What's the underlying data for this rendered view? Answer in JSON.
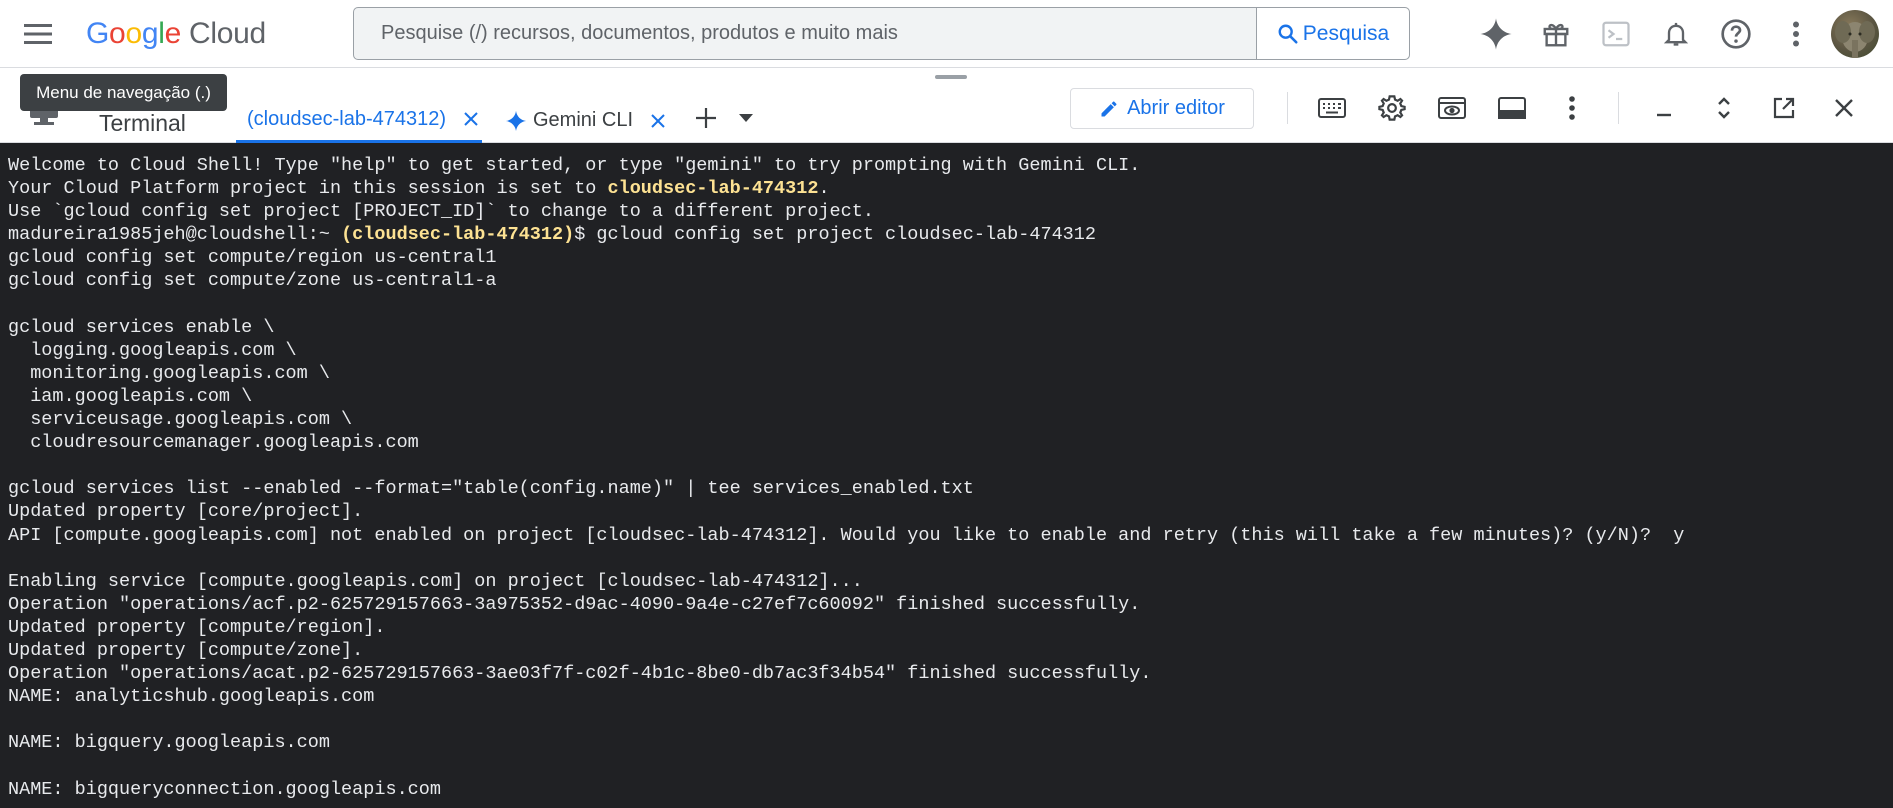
{
  "header": {
    "menu_icon": "hamburger-menu-icon",
    "logo_letters": [
      "G",
      "o",
      "o",
      "g",
      "l",
      "e"
    ],
    "logo_cloud": "Cloud",
    "search_placeholder": "Pesquise (/) recursos, documentos, produtos e muito mais",
    "search_button_label": "Pesquisa",
    "icons": [
      "gemini-icon",
      "gift-icon",
      "cloud-shell-icon",
      "notifications-icon",
      "help-icon",
      "more-vert-icon",
      "account-avatar"
    ]
  },
  "tooltip": "Menu de navegação (.)",
  "shell": {
    "title": "Terminal",
    "tabs": [
      {
        "label": "(cloudsec-lab-474312)",
        "active": true
      },
      {
        "label": "Gemini CLI",
        "active": false
      }
    ],
    "open_editor_label": "Abrir editor",
    "toolbar_icons": [
      "keyboard-icon",
      "settings-icon",
      "web-preview-icon",
      "layout-icon",
      "more-vert-icon",
      "minimize-icon",
      "expand-icon",
      "open-new-window-icon",
      "close-icon"
    ]
  },
  "colors": {
    "accent": "#1a73e8",
    "terminal_bg": "#202124",
    "terminal_text": "#e8eaed",
    "terminal_highlight": "#fde293"
  },
  "terminal": {
    "lines": [
      {
        "t": "Welcome to Cloud Shell! Type \"help\" to get started, or type \"gemini\" to try prompting with Gemini CLI."
      },
      {
        "t": "Your Cloud Platform project in this session is set to ",
        "h": "cloudsec-lab-474312",
        "a": "."
      },
      {
        "t": "Use `gcloud config set project [PROJECT_ID]` to change to a different project."
      },
      {
        "t": "madureira1985jeh@cloudshell:~ ",
        "h": "(cloudsec-lab-474312)",
        "a": "$ gcloud config set project cloudsec-lab-474312"
      },
      {
        "t": "gcloud config set compute/region us-central1"
      },
      {
        "t": "gcloud config set compute/zone us-central1-a"
      },
      {
        "t": ""
      },
      {
        "t": "gcloud services enable \\"
      },
      {
        "t": "  logging.googleapis.com \\"
      },
      {
        "t": "  monitoring.googleapis.com \\"
      },
      {
        "t": "  iam.googleapis.com \\"
      },
      {
        "t": "  serviceusage.googleapis.com \\"
      },
      {
        "t": "  cloudresourcemanager.googleapis.com"
      },
      {
        "t": ""
      },
      {
        "t": "gcloud services list --enabled --format=\"table(config.name)\" | tee services_enabled.txt"
      },
      {
        "t": "Updated property [core/project]."
      },
      {
        "t": "API [compute.googleapis.com] not enabled on project [cloudsec-lab-474312]. Would you like to enable and retry (this will take a few minutes)? (y/N)?  y"
      },
      {
        "t": ""
      },
      {
        "t": "Enabling service [compute.googleapis.com] on project [cloudsec-lab-474312]..."
      },
      {
        "t": "Operation \"operations/acf.p2-625729157663-3a975352-d9ac-4090-9a4e-c27ef7c60092\" finished successfully."
      },
      {
        "t": "Updated property [compute/region]."
      },
      {
        "t": "Updated property [compute/zone]."
      },
      {
        "t": "Operation \"operations/acat.p2-625729157663-3ae03f7f-c02f-4b1c-8be0-db7ac3f34b54\" finished successfully."
      },
      {
        "t": "NAME: analyticshub.googleapis.com"
      },
      {
        "t": ""
      },
      {
        "t": "NAME: bigquery.googleapis.com"
      },
      {
        "t": ""
      },
      {
        "t": "NAME: bigqueryconnection.googleapis.com"
      }
    ]
  }
}
